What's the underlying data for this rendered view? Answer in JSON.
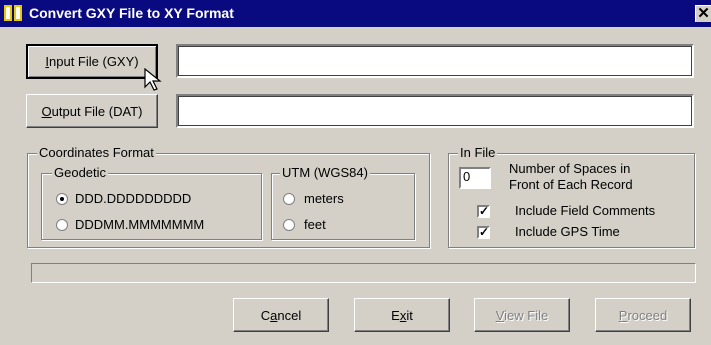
{
  "window": {
    "title": "Convert GXY File to XY Format",
    "close_glyph": "✕"
  },
  "buttons": {
    "input_file": {
      "pre": "",
      "key": "I",
      "post": "nput File (GXY)"
    },
    "output_file": {
      "pre": "",
      "key": "O",
      "post": "utput File (DAT)"
    },
    "cancel": {
      "pre": "C",
      "key": "a",
      "post": "ncel"
    },
    "exit": {
      "pre": "E",
      "key": "x",
      "post": "it"
    },
    "view_file": {
      "pre": "",
      "key": "V",
      "post": "iew File"
    },
    "proceed": {
      "pre": "",
      "key": "P",
      "post": "roceed"
    }
  },
  "fields": {
    "input_file_value": "",
    "output_file_value": ""
  },
  "coordinates": {
    "legend": "Coordinates Format",
    "geodetic": {
      "legend": "Geodetic",
      "options": [
        "DDD.DDDDDDDDD",
        "DDDMM.MMMMMMM"
      ],
      "selected": 0
    },
    "utm": {
      "legend": "UTM (WGS84)",
      "options": [
        "meters",
        "feet"
      ],
      "selected": null
    }
  },
  "in_file": {
    "legend": "In File",
    "spaces_value": "0",
    "spaces_label_1": "Number of Spaces in",
    "spaces_label_2": "Front of Each Record",
    "include_comments": {
      "label": "Include Field Comments",
      "checked": true,
      "mark": "✓"
    },
    "include_gps_time": {
      "label": "Include GPS Time",
      "checked": true,
      "mark": "✓"
    }
  },
  "progress": {
    "value": 0
  },
  "colors": {
    "titlebar": "#0a0a80",
    "face": "#d4d0c8",
    "disabled_text": "#808080"
  },
  "icons": {
    "app": "window-app-icon",
    "cursor": "mouse-pointer-icon"
  }
}
